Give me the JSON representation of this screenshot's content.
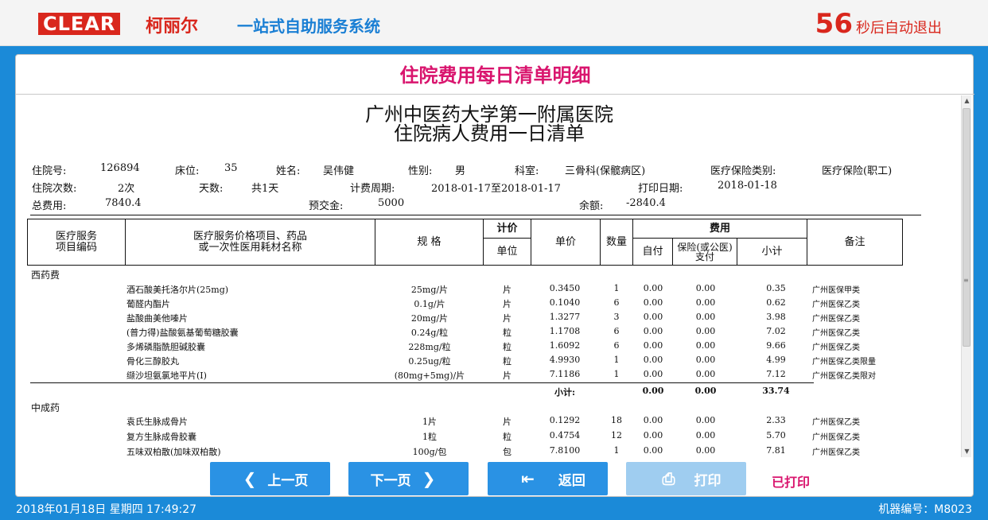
{
  "header": {
    "logo_text": "CLEAR",
    "brand_cn": "柯丽尔",
    "system_title": "一站式自助服务系统",
    "countdown_seconds": "56",
    "countdown_text": "秒后自动退出",
    "accent_color": "#d9271d",
    "title_color": "#1a7fd4"
  },
  "panel": {
    "title": "住院费用每日清单明细"
  },
  "document": {
    "hospital_name": "广州中医药大学第一附属医院",
    "title": "住院病人费用一日清单",
    "info": {
      "admission_no_label": "住院号:",
      "admission_no": "126894",
      "bed_label": "床位:",
      "bed": "35",
      "name_label": "姓名:",
      "name": "吴伟健",
      "gender_label": "性别:",
      "gender": "男",
      "dept_label": "科室:",
      "dept": "三骨科(保髋病区)",
      "insurance_label": "医疗保险类别:",
      "insurance": "医疗保险(职工)",
      "admissions_label": "住院次数:",
      "admissions": "2次",
      "days_label": "天数:",
      "days": "共1天",
      "period_label": "计费周期:",
      "period": "2018-01-17至2018-01-17",
      "print_date_label": "打印日期:",
      "print_date": "2018-01-18",
      "total_label": "总费用:",
      "total": "7840.4",
      "deposit_label": "预交金:",
      "deposit": "5000",
      "balance_label": "余额:",
      "balance": "-2840.4"
    },
    "table_header": {
      "code": "医疗服务\n项目编码",
      "item": "医疗服务价格项目、药品\n或一次性医用耗材名称",
      "spec": "规  格",
      "pricing": "计价",
      "unit": "单位",
      "price": "单价",
      "qty": "数量",
      "fee": "费用",
      "self_pay": "自付",
      "insurance_pay": "保险(或公医)支付",
      "subtotal": "小计",
      "note": "备注"
    },
    "categories": [
      {
        "name": "西药费",
        "rows": [
          {
            "name": "酒石酸美托洛尔片(25mg)",
            "spec": "25mg/片",
            "unit": "片",
            "price": "0.3450",
            "qty": "1",
            "self": "0.00",
            "ins": "0.00",
            "sub": "0.35",
            "note": "广州医保甲类"
          },
          {
            "name": "葡醛内酯片",
            "spec": "0.1g/片",
            "unit": "片",
            "price": "0.1040",
            "qty": "6",
            "self": "0.00",
            "ins": "0.00",
            "sub": "0.62",
            "note": "广州医保乙类"
          },
          {
            "name": "盐酸曲美他嗪片",
            "spec": "20mg/片",
            "unit": "片",
            "price": "1.3277",
            "qty": "3",
            "self": "0.00",
            "ins": "0.00",
            "sub": "3.98",
            "note": "广州医保乙类"
          },
          {
            "name": "(普力得)盐酸氨基葡萄糖胶囊",
            "spec": "0.24g/粒",
            "unit": "粒",
            "price": "1.1708",
            "qty": "6",
            "self": "0.00",
            "ins": "0.00",
            "sub": "7.02",
            "note": "广州医保乙类"
          },
          {
            "name": "多烯磷脂酰胆碱胶囊",
            "spec": "228mg/粒",
            "unit": "粒",
            "price": "1.6092",
            "qty": "6",
            "self": "0.00",
            "ins": "0.00",
            "sub": "9.66",
            "note": "广州医保乙类"
          },
          {
            "name": "骨化三醇胶丸",
            "spec": "0.25ug/粒",
            "unit": "粒",
            "price": "4.9930",
            "qty": "1",
            "self": "0.00",
            "ins": "0.00",
            "sub": "4.99",
            "note": "广州医保乙类限量"
          },
          {
            "name": "缬沙坦氨氯地平片(Ⅰ)",
            "spec": "(80mg+5mg)/片",
            "unit": "片",
            "price": "7.1186",
            "qty": "1",
            "self": "0.00",
            "ins": "0.00",
            "sub": "7.12",
            "note": "广州医保乙类限对"
          }
        ],
        "subtotal_label": "小计:",
        "subtotal_self": "0.00",
        "subtotal_ins": "0.00",
        "subtotal": "33.74"
      },
      {
        "name": "中成药",
        "rows": [
          {
            "name": "袁氏生脉成骨片",
            "spec": "1片",
            "unit": "片",
            "price": "0.1292",
            "qty": "18",
            "self": "0.00",
            "ins": "0.00",
            "sub": "2.33",
            "note": "广州医保乙类"
          },
          {
            "name": "复方生脉成骨胶囊",
            "spec": "1粒",
            "unit": "粒",
            "price": "0.4754",
            "qty": "12",
            "self": "0.00",
            "ins": "0.00",
            "sub": "5.70",
            "note": "广州医保乙类"
          },
          {
            "name": "五味双柏散(加味双柏散)",
            "spec": "100g/包",
            "unit": "包",
            "price": "7.8100",
            "qty": "1",
            "self": "0.00",
            "ins": "0.00",
            "sub": "7.81",
            "note": "广州医保乙类"
          }
        ]
      }
    ]
  },
  "buttons": {
    "prev": "上一页",
    "next": "下一页",
    "back": "返回",
    "print": "打印",
    "printed_status": "已打印"
  },
  "footer": {
    "datetime": "2018年01月18日    星期四    17:49:27",
    "machine": "机器编号：M8023"
  }
}
